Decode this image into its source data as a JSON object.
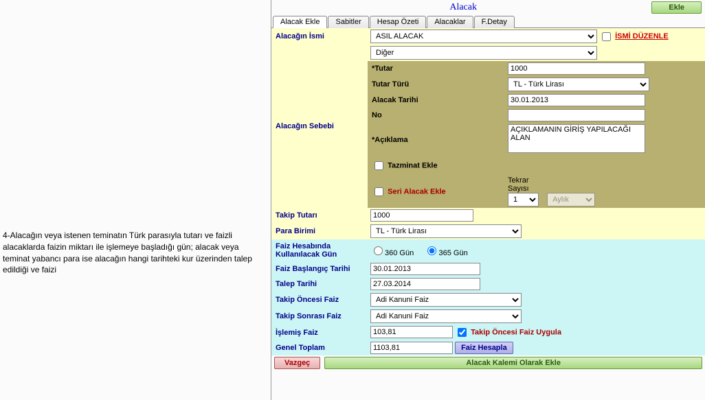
{
  "leftPanel": {
    "text": "4-Alacağın veya istenen teminatın Türk parasıyla tutarı ve faizli alacaklarda faizin miktarı ile işlemeye başladığı gün; alacak veya teminat yabancı para ise alacağın hangi tarihteki kur üzerinden talep edildiği ve faizi"
  },
  "header": {
    "title": "Alacak",
    "addBtn": "Ekle"
  },
  "tabs": {
    "t0": "Alacak Ekle",
    "t1": "Sabitler",
    "t2": "Hesap Özeti",
    "t3": "Alacaklar",
    "t4": "F.Detay"
  },
  "labels": {
    "alacaginIsmi": "Alacağın İsmi",
    "alacaginSebebi": "Alacağın Sebebi",
    "tutar": "*Tutar",
    "tutarTuru": "Tutar Türü",
    "alacakTarihi": "Alacak Tarihi",
    "no": "No",
    "aciklama": "*Açıklama",
    "tazminatEkle": "Tazminat Ekle",
    "seriAlacakEkle": "Seri Alacak Ekle",
    "tekrarSayisi": "Tekrar Sayısı",
    "takipTutari": "Takip Tutarı",
    "paraBirimi": "Para Birimi",
    "faizGun": "Faiz Hesabında Kullanılacak Gün",
    "g360": "360 Gün",
    "g365": "365 Gün",
    "faizBaslangic": "Faiz Başlangıç Tarihi",
    "talepTarihi": "Talep Tarihi",
    "takipOncesi": "Takip Öncesi Faiz",
    "takipSonrasi": "Takip Sonrası Faiz",
    "islemisFaiz": "İşlemiş Faiz",
    "takipOncesiUygula": "Takip Öncesi Faiz Uygula",
    "genelToplam": "Genel Toplam",
    "faizHesapla": "Faiz Hesapla",
    "vazgec": "Vazgeç",
    "alacakKalemi": "Alacak Kalemi Olarak Ekle",
    "ismiDuzenle": "İSMİ DÜZENLE"
  },
  "values": {
    "alacaginIsmi": "ASIL ALACAK",
    "sebep": "Diğer",
    "tutar": "1000",
    "tutarTuru": "TL - Türk Lirası",
    "alacakTarihi": "30.01.2013",
    "no": "",
    "aciklama": "AÇIKLAMANIN GİRİŞ YAPILACAĞI ALAN",
    "tekrarSayisi": "1",
    "tekrarPeriod": "Aylık",
    "takipTutari": "1000",
    "paraBirimi": "TL - Türk Lirası",
    "faizBaslangic": "30.01.2013",
    "talepTarihi": "27.03.2014",
    "takipOncesi": "Adi Kanuni Faiz",
    "takipSonrasi": "Adi Kanuni Faiz",
    "islemisFaiz": "103,81",
    "genelToplam": "1103,81"
  }
}
